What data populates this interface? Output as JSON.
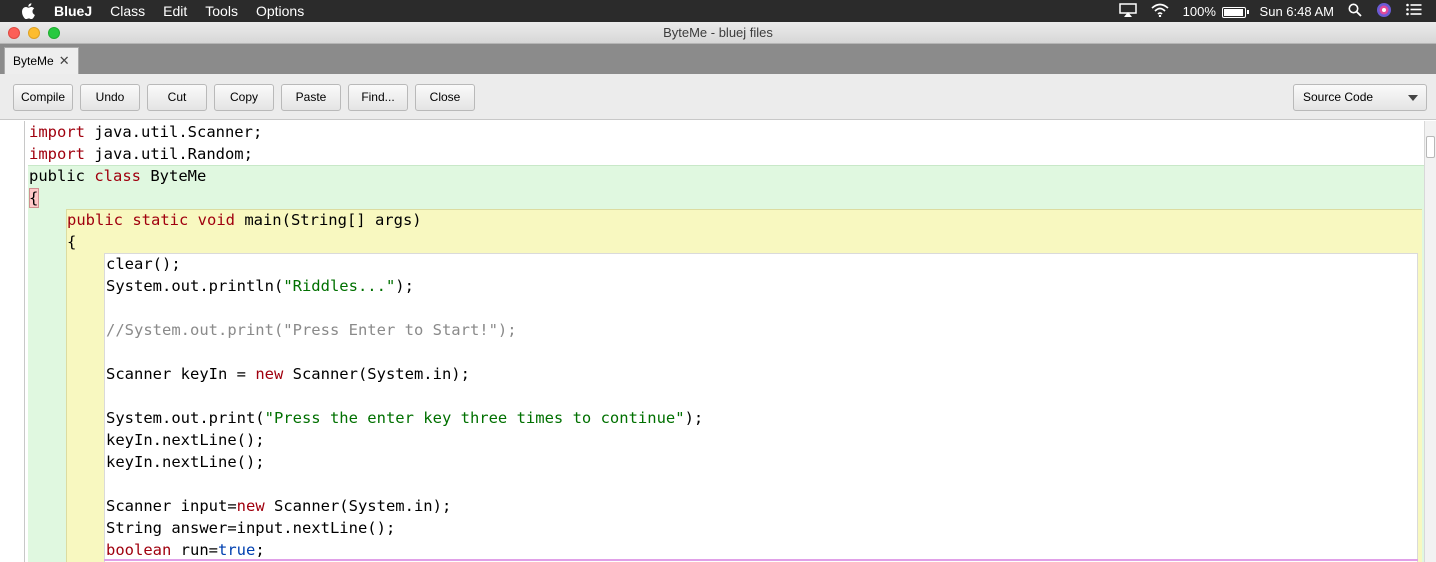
{
  "menubar": {
    "app_name": "BlueJ",
    "items": [
      "Class",
      "Edit",
      "Tools",
      "Options"
    ],
    "battery": "100%",
    "battery_level": 1.0,
    "clock": "Sun 6:48 AM"
  },
  "window": {
    "title": "ByteMe - bluej files"
  },
  "tab": {
    "label": "ByteMe",
    "close": "✕"
  },
  "toolbar": {
    "compile": "Compile",
    "undo": "Undo",
    "cut": "Cut",
    "copy": "Copy",
    "paste": "Paste",
    "find": "Find...",
    "close": "Close",
    "view_select": "Source Code"
  },
  "code": {
    "l1_kw": "import",
    "l1_rest": " java.util.Scanner;",
    "l2_kw": "import",
    "l2_rest": " java.util.Random;",
    "l3_a": "public",
    "l3_kw": " class",
    "l3_rest": " ByteMe",
    "l4": "{",
    "l5_a": "public",
    "l5_kw": " static void",
    "l5_rest": " main(String[] args)",
    "l6": "{",
    "l7": "clear();",
    "l8_a": "System.out.println(",
    "l8_str": "\"Riddles...\"",
    "l8_b": ");",
    "l10": "//System.out.print(\"Press Enter to Start!\");",
    "l12_a": "Scanner keyIn = ",
    "l12_kw": "new",
    "l12_b": " Scanner(System.in);",
    "l14_a": "System.out.print(",
    "l14_str": "\"Press the enter key three times to continue\"",
    "l14_b": ");",
    "l15": "keyIn.nextLine();",
    "l16": "keyIn.nextLine();",
    "l18_a": "Scanner input=",
    "l18_kw": "new",
    "l18_b": " Scanner(System.in);",
    "l19": "String answer=input.nextLine();",
    "l20_kw": "boolean",
    "l20_a": " run=",
    "l20_lit": "true",
    "l20_b": ";"
  },
  "colors": {
    "keyword": "#a0000e",
    "string": "#007000",
    "comment": "#8a8a8a",
    "literal": "#0040b0",
    "class_scope": "#e0f8e0",
    "method_scope": "#f8f8c0"
  }
}
